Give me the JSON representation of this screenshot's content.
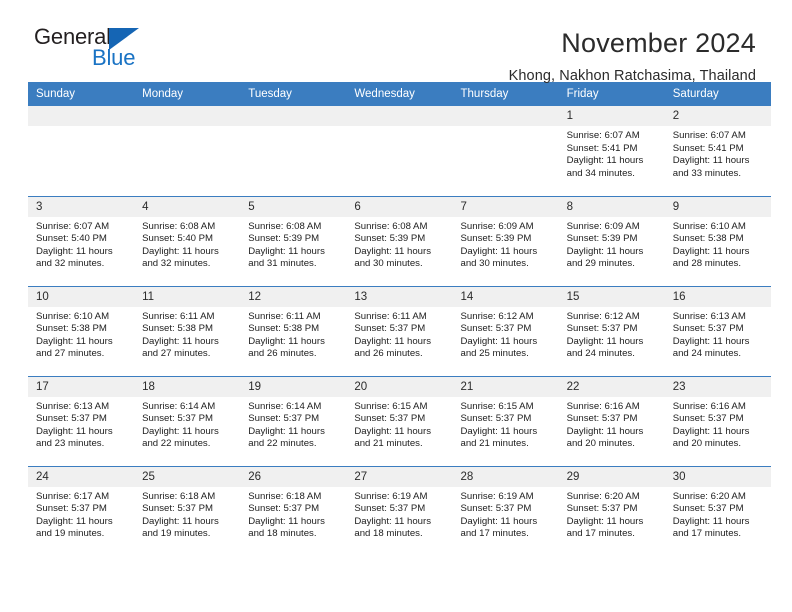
{
  "logo": {
    "word1": "General",
    "word2": "Blue",
    "triangle_color": "#1565b4",
    "word2_color": "#1a73c4"
  },
  "header": {
    "title": "November 2024",
    "subtitle": "Khong, Nakhon Ratchasima, Thailand"
  },
  "theme": {
    "header_bg": "#3b7dc0",
    "daynum_bg": "#f0f0f0",
    "rule_color": "#3b7dc0",
    "text_color": "#1d1d1d"
  },
  "calendar": {
    "weekday_headers": [
      "Sunday",
      "Monday",
      "Tuesday",
      "Wednesday",
      "Thursday",
      "Friday",
      "Saturday"
    ],
    "labels": {
      "sunrise": "Sunrise:",
      "sunset": "Sunset:",
      "daylight": "Daylight:"
    },
    "weeks": [
      [
        {
          "day": "",
          "empty": true
        },
        {
          "day": "",
          "empty": true
        },
        {
          "day": "",
          "empty": true
        },
        {
          "day": "",
          "empty": true
        },
        {
          "day": "",
          "empty": true
        },
        {
          "day": "1",
          "sunrise": "Sunrise: 6:07 AM",
          "sunset": "Sunset: 5:41 PM",
          "daylight_1": "Daylight: 11 hours",
          "daylight_2": "and 34 minutes."
        },
        {
          "day": "2",
          "sunrise": "Sunrise: 6:07 AM",
          "sunset": "Sunset: 5:41 PM",
          "daylight_1": "Daylight: 11 hours",
          "daylight_2": "and 33 minutes."
        }
      ],
      [
        {
          "day": "3",
          "sunrise": "Sunrise: 6:07 AM",
          "sunset": "Sunset: 5:40 PM",
          "daylight_1": "Daylight: 11 hours",
          "daylight_2": "and 32 minutes."
        },
        {
          "day": "4",
          "sunrise": "Sunrise: 6:08 AM",
          "sunset": "Sunset: 5:40 PM",
          "daylight_1": "Daylight: 11 hours",
          "daylight_2": "and 32 minutes."
        },
        {
          "day": "5",
          "sunrise": "Sunrise: 6:08 AM",
          "sunset": "Sunset: 5:39 PM",
          "daylight_1": "Daylight: 11 hours",
          "daylight_2": "and 31 minutes."
        },
        {
          "day": "6",
          "sunrise": "Sunrise: 6:08 AM",
          "sunset": "Sunset: 5:39 PM",
          "daylight_1": "Daylight: 11 hours",
          "daylight_2": "and 30 minutes."
        },
        {
          "day": "7",
          "sunrise": "Sunrise: 6:09 AM",
          "sunset": "Sunset: 5:39 PM",
          "daylight_1": "Daylight: 11 hours",
          "daylight_2": "and 30 minutes."
        },
        {
          "day": "8",
          "sunrise": "Sunrise: 6:09 AM",
          "sunset": "Sunset: 5:39 PM",
          "daylight_1": "Daylight: 11 hours",
          "daylight_2": "and 29 minutes."
        },
        {
          "day": "9",
          "sunrise": "Sunrise: 6:10 AM",
          "sunset": "Sunset: 5:38 PM",
          "daylight_1": "Daylight: 11 hours",
          "daylight_2": "and 28 minutes."
        }
      ],
      [
        {
          "day": "10",
          "sunrise": "Sunrise: 6:10 AM",
          "sunset": "Sunset: 5:38 PM",
          "daylight_1": "Daylight: 11 hours",
          "daylight_2": "and 27 minutes."
        },
        {
          "day": "11",
          "sunrise": "Sunrise: 6:11 AM",
          "sunset": "Sunset: 5:38 PM",
          "daylight_1": "Daylight: 11 hours",
          "daylight_2": "and 27 minutes."
        },
        {
          "day": "12",
          "sunrise": "Sunrise: 6:11 AM",
          "sunset": "Sunset: 5:38 PM",
          "daylight_1": "Daylight: 11 hours",
          "daylight_2": "and 26 minutes."
        },
        {
          "day": "13",
          "sunrise": "Sunrise: 6:11 AM",
          "sunset": "Sunset: 5:37 PM",
          "daylight_1": "Daylight: 11 hours",
          "daylight_2": "and 26 minutes."
        },
        {
          "day": "14",
          "sunrise": "Sunrise: 6:12 AM",
          "sunset": "Sunset: 5:37 PM",
          "daylight_1": "Daylight: 11 hours",
          "daylight_2": "and 25 minutes."
        },
        {
          "day": "15",
          "sunrise": "Sunrise: 6:12 AM",
          "sunset": "Sunset: 5:37 PM",
          "daylight_1": "Daylight: 11 hours",
          "daylight_2": "and 24 minutes."
        },
        {
          "day": "16",
          "sunrise": "Sunrise: 6:13 AM",
          "sunset": "Sunset: 5:37 PM",
          "daylight_1": "Daylight: 11 hours",
          "daylight_2": "and 24 minutes."
        }
      ],
      [
        {
          "day": "17",
          "sunrise": "Sunrise: 6:13 AM",
          "sunset": "Sunset: 5:37 PM",
          "daylight_1": "Daylight: 11 hours",
          "daylight_2": "and 23 minutes."
        },
        {
          "day": "18",
          "sunrise": "Sunrise: 6:14 AM",
          "sunset": "Sunset: 5:37 PM",
          "daylight_1": "Daylight: 11 hours",
          "daylight_2": "and 22 minutes."
        },
        {
          "day": "19",
          "sunrise": "Sunrise: 6:14 AM",
          "sunset": "Sunset: 5:37 PM",
          "daylight_1": "Daylight: 11 hours",
          "daylight_2": "and 22 minutes."
        },
        {
          "day": "20",
          "sunrise": "Sunrise: 6:15 AM",
          "sunset": "Sunset: 5:37 PM",
          "daylight_1": "Daylight: 11 hours",
          "daylight_2": "and 21 minutes."
        },
        {
          "day": "21",
          "sunrise": "Sunrise: 6:15 AM",
          "sunset": "Sunset: 5:37 PM",
          "daylight_1": "Daylight: 11 hours",
          "daylight_2": "and 21 minutes."
        },
        {
          "day": "22",
          "sunrise": "Sunrise: 6:16 AM",
          "sunset": "Sunset: 5:37 PM",
          "daylight_1": "Daylight: 11 hours",
          "daylight_2": "and 20 minutes."
        },
        {
          "day": "23",
          "sunrise": "Sunrise: 6:16 AM",
          "sunset": "Sunset: 5:37 PM",
          "daylight_1": "Daylight: 11 hours",
          "daylight_2": "and 20 minutes."
        }
      ],
      [
        {
          "day": "24",
          "sunrise": "Sunrise: 6:17 AM",
          "sunset": "Sunset: 5:37 PM",
          "daylight_1": "Daylight: 11 hours",
          "daylight_2": "and 19 minutes."
        },
        {
          "day": "25",
          "sunrise": "Sunrise: 6:18 AM",
          "sunset": "Sunset: 5:37 PM",
          "daylight_1": "Daylight: 11 hours",
          "daylight_2": "and 19 minutes."
        },
        {
          "day": "26",
          "sunrise": "Sunrise: 6:18 AM",
          "sunset": "Sunset: 5:37 PM",
          "daylight_1": "Daylight: 11 hours",
          "daylight_2": "and 18 minutes."
        },
        {
          "day": "27",
          "sunrise": "Sunrise: 6:19 AM",
          "sunset": "Sunset: 5:37 PM",
          "daylight_1": "Daylight: 11 hours",
          "daylight_2": "and 18 minutes."
        },
        {
          "day": "28",
          "sunrise": "Sunrise: 6:19 AM",
          "sunset": "Sunset: 5:37 PM",
          "daylight_1": "Daylight: 11 hours",
          "daylight_2": "and 17 minutes."
        },
        {
          "day": "29",
          "sunrise": "Sunrise: 6:20 AM",
          "sunset": "Sunset: 5:37 PM",
          "daylight_1": "Daylight: 11 hours",
          "daylight_2": "and 17 minutes."
        },
        {
          "day": "30",
          "sunrise": "Sunrise: 6:20 AM",
          "sunset": "Sunset: 5:37 PM",
          "daylight_1": "Daylight: 11 hours",
          "daylight_2": "and 17 minutes."
        }
      ]
    ]
  }
}
